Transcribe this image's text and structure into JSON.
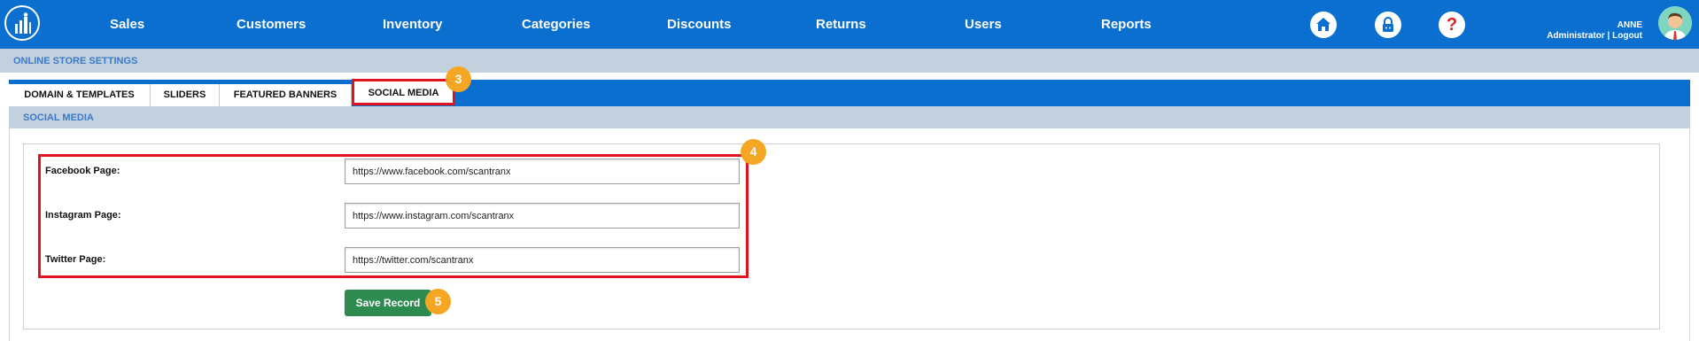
{
  "nav": {
    "items": [
      {
        "label": "Sales"
      },
      {
        "label": "Customers"
      },
      {
        "label": "Inventory"
      },
      {
        "label": "Categories"
      },
      {
        "label": "Discounts"
      },
      {
        "label": "Returns"
      },
      {
        "label": "Users"
      },
      {
        "label": "Reports"
      }
    ],
    "help_glyph": "?",
    "user": {
      "name": "ANNE",
      "role": "Administrator",
      "separator": " | ",
      "logout": "Logout"
    }
  },
  "settings_title": "ONLINE STORE SETTINGS",
  "tabs": [
    {
      "label": "DOMAIN & TEMPLATES"
    },
    {
      "label": "SLIDERS"
    },
    {
      "label": "FEATURED BANNERS"
    },
    {
      "label": "SOCIAL MEDIA",
      "active": true
    }
  ],
  "badges": {
    "tab": "3",
    "fields": "4",
    "save": "5"
  },
  "panel_title": "SOCIAL MEDIA",
  "fields": [
    {
      "label": "Facebook Page:",
      "value": "https://www.facebook.com/scantranx"
    },
    {
      "label": "Instagram Page:",
      "value": "https://www.instagram.com/scantranx"
    },
    {
      "label": "Twitter Page:",
      "value": "https://twitter.com/scantranx"
    }
  ],
  "save_label": "Save Record",
  "icons": {
    "logo": "store-logo-icon",
    "home": "home-icon",
    "lock": "lock-icon",
    "help": "help-icon",
    "avatar": "user-avatar"
  },
  "colors": {
    "nav_blue": "#0a6fcf",
    "strip_gray": "#c2d1dd",
    "highlight_red": "#e0141e",
    "badge_orange": "#f5a623",
    "save_green": "#2e8b4f"
  }
}
